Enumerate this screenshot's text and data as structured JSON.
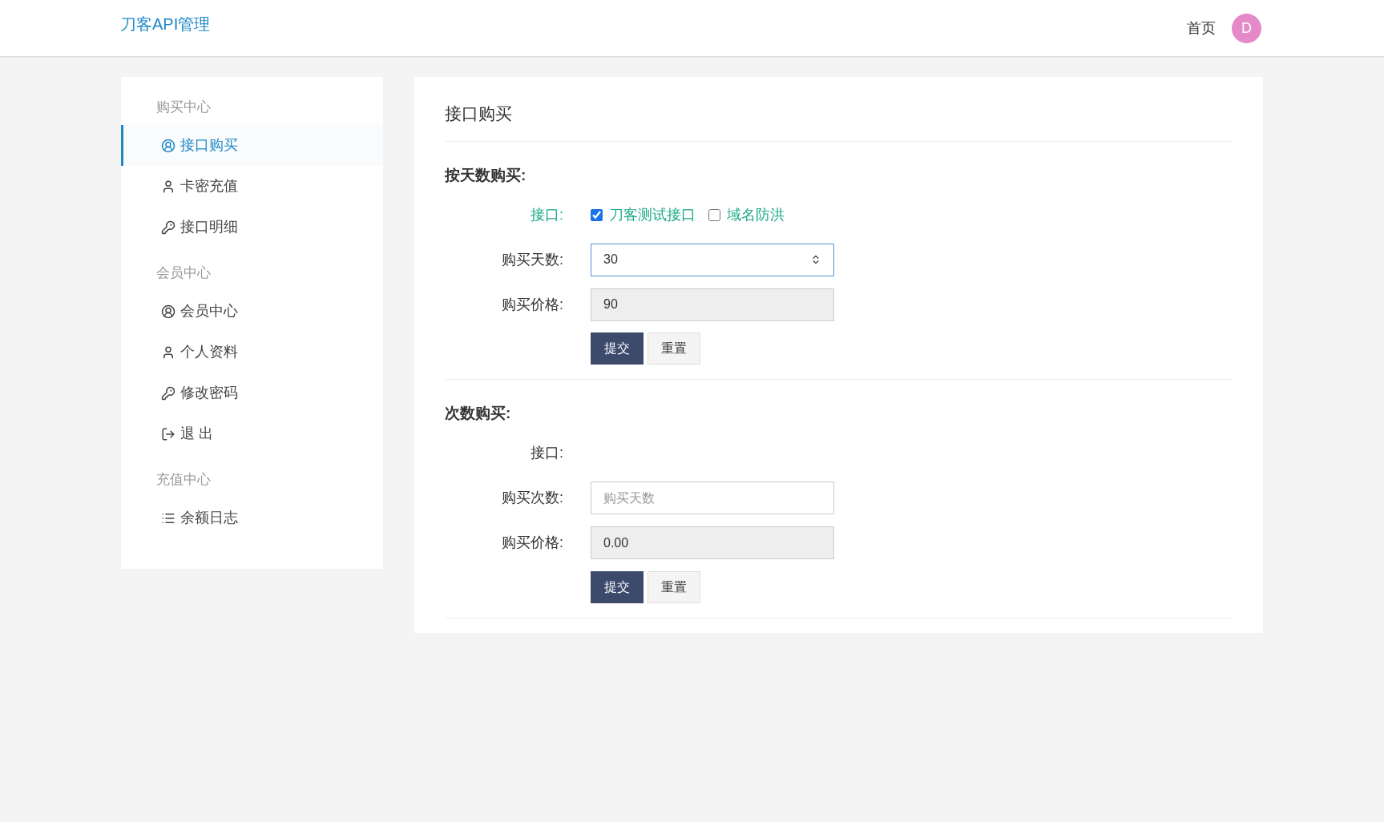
{
  "header": {
    "brand": "刀客API管理",
    "nav": "首页",
    "avatar": "D"
  },
  "sidebar": {
    "groups": [
      {
        "title": "购买中心",
        "items": [
          {
            "label": "接口购买",
            "kind": "account",
            "selected": true
          },
          {
            "label": "卡密充值",
            "kind": "person",
            "selected": false
          },
          {
            "label": "接口明细",
            "kind": "password",
            "selected": false
          }
        ]
      },
      {
        "title": "会员中心",
        "items": [
          {
            "label": "会员中心",
            "kind": "account",
            "selected": false
          },
          {
            "label": "个人资料",
            "kind": "person",
            "selected": false
          },
          {
            "label": "修改密码",
            "kind": "password",
            "selected": false
          },
          {
            "label": "退 出",
            "kind": "logout",
            "selected": false
          }
        ]
      },
      {
        "title": "充值中心",
        "items": [
          {
            "label": "余额日志",
            "kind": "log",
            "selected": false
          }
        ]
      }
    ]
  },
  "main": {
    "title": "接口购买",
    "sections": [
      {
        "title": "按天数购买:",
        "rows": [
          {
            "kind": "checks",
            "label": "接口:",
            "options": [
              {
                "label": "刀客测试接口",
                "checked": true
              },
              {
                "label": "域名防洪",
                "checked": false
              }
            ]
          },
          {
            "kind": "number",
            "label": "购买天数:",
            "value": "30"
          },
          {
            "kind": "readonly",
            "label": "购买价格:",
            "value": "90"
          }
        ],
        "buttons": [
          "提交",
          "重置"
        ]
      },
      {
        "title": "次数购买:",
        "rows": [
          {
            "kind": "checks",
            "label": "接口:",
            "options": []
          },
          {
            "kind": "text",
            "label": "购买次数:",
            "placeholder": "购买天数"
          },
          {
            "kind": "readonly",
            "label": "购买价格:",
            "value": "0.00"
          }
        ],
        "buttons": [
          "提交",
          "重置"
        ]
      }
    ]
  }
}
